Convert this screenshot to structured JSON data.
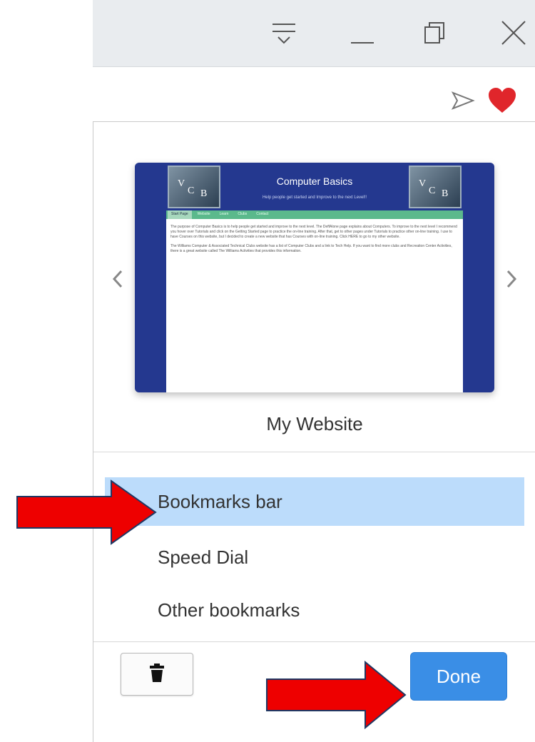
{
  "window_controls": {
    "menu_icon": "tab-menu-icon",
    "minimize_icon": "minimize-icon",
    "restore_icon": "restore-icon",
    "close_icon": "close-icon"
  },
  "address_bar": {
    "send_icon": "send-icon",
    "heart_icon": "heart-icon",
    "heart_color": "#e0262b"
  },
  "popup": {
    "thumbnail": {
      "logo_text": [
        "V",
        "C",
        "B"
      ],
      "title": "Computer Basics",
      "subtitle": "Help people get started and Improve to the next Level!!",
      "nav_items": [
        "Start Page",
        "Website",
        "Learn",
        "Clubs",
        "Contact"
      ],
      "paragraphs": [
        "The purpose of Computer Basics is to help people get started and improve to the next level. The DeffAlone page explains about Computers. To improve to the next level I recommend you hover over Tutorials and click on the Getting Started page to practice the on-line training. After that, get to other pages under Tutorials to practice other on-line training. I use to have Courses on this website, but I decided to create a new website that has Courses with on-line training. Click HERE to go to my other website.",
        "The Williams Computer & Associated Technical Clubs website has a list of Computer Clubs and a link to Tech Help. If you want to find more clubs and Recreation Center Activities, there is a great website called The Williams Activities that provides this information."
      ]
    },
    "bookmark_name": "My Website",
    "folders": [
      {
        "label": "Bookmarks bar",
        "selected": true
      },
      {
        "label": "Speed Dial",
        "selected": false
      },
      {
        "label": "Other bookmarks",
        "selected": false
      }
    ],
    "delete_icon": "trash-icon",
    "done_label": "Done",
    "accent_color": "#3a8ee6",
    "selection_color": "#bcdcfb"
  },
  "annotations": {
    "arrow_color": "#ee0000"
  }
}
